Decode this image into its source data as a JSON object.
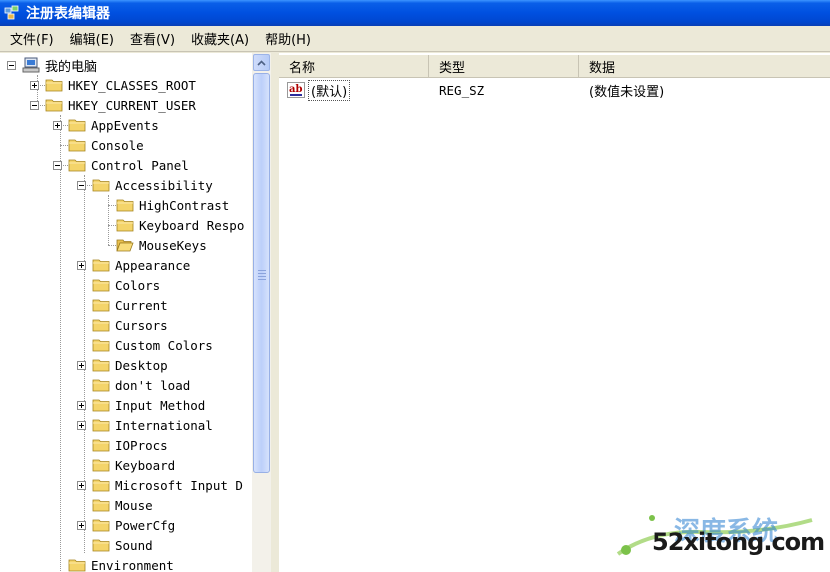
{
  "window": {
    "title": "注册表编辑器"
  },
  "menu": [
    "文件(F)",
    "编辑(E)",
    "查看(V)",
    "收藏夹(A)",
    "帮助(H)"
  ],
  "tree": {
    "root": "我的电脑",
    "nodes": [
      "HKEY_CLASSES_ROOT",
      "HKEY_CURRENT_USER",
      "AppEvents",
      "Console",
      "Control Panel",
      "Accessibility",
      "HighContrast",
      "Keyboard Respo",
      "MouseKeys",
      "Appearance",
      "Colors",
      "Current",
      "Cursors",
      "Custom Colors",
      "Desktop",
      "don't load",
      "Input Method",
      "International",
      "IOProcs",
      "Keyboard",
      "Microsoft Input D",
      "Mouse",
      "PowerCfg",
      "Sound",
      "Environment"
    ]
  },
  "list": {
    "columns": [
      "名称",
      "类型",
      "数据"
    ],
    "rows": [
      {
        "name": "(默认)",
        "type": "REG_SZ",
        "data": "(数值未设置)"
      }
    ]
  },
  "watermark": {
    "brand": "深度系统",
    "domain": "52xitong.com"
  },
  "colors": {
    "titlebar": "#0050e0",
    "folder": "#f4d46a",
    "selection": "#316ac5"
  }
}
